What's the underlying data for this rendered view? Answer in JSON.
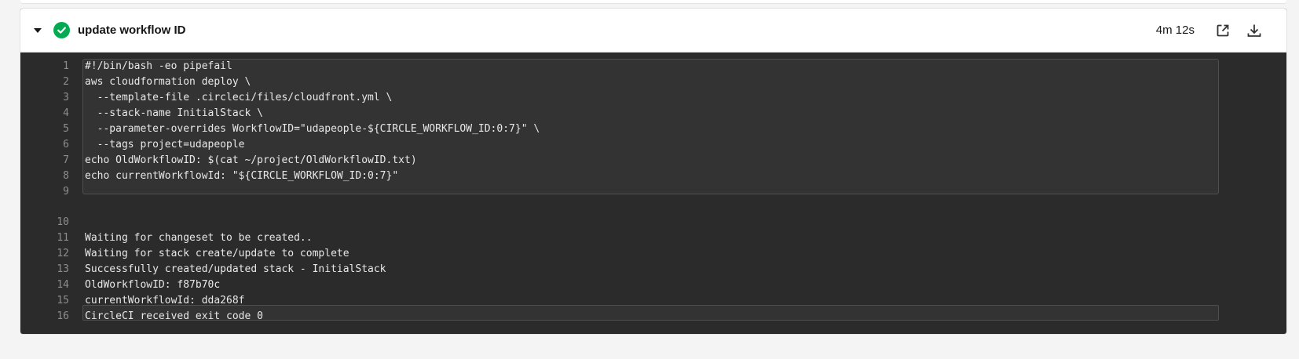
{
  "step": {
    "title": "update workflow ID",
    "duration": "4m 12s",
    "status": "success",
    "status_color": "#04aa51",
    "icons": {
      "toggle": "caret-down-icon",
      "status": "check-circle-icon",
      "external": "external-link-icon",
      "download": "download-icon"
    }
  },
  "command": {
    "lines": [
      {
        "n": "1",
        "t": "#!/bin/bash -eo pipefail"
      },
      {
        "n": "2",
        "t": "aws cloudformation deploy \\"
      },
      {
        "n": "3",
        "t": "  --template-file .circleci/files/cloudfront.yml \\"
      },
      {
        "n": "4",
        "t": "  --stack-name InitialStack \\"
      },
      {
        "n": "5",
        "t": "  --parameter-overrides WorkflowID=\"udapeople-${CIRCLE_WORKFLOW_ID:0:7}\" \\"
      },
      {
        "n": "6",
        "t": "  --tags project=udapeople"
      },
      {
        "n": "7",
        "t": "echo OldWorkflowID: $(cat ~/project/OldWorkflowID.txt)"
      },
      {
        "n": "8",
        "t": "echo currentWorkflowId: \"${CIRCLE_WORKFLOW_ID:0:7}\""
      },
      {
        "n": "9",
        "t": ""
      }
    ]
  },
  "output": {
    "lines": [
      {
        "n": "10",
        "t": ""
      },
      {
        "n": "11",
        "t": "Waiting for changeset to be created.."
      },
      {
        "n": "12",
        "t": "Waiting for stack create/update to complete"
      },
      {
        "n": "13",
        "t": "Successfully created/updated stack - InitialStack"
      },
      {
        "n": "14",
        "t": "OldWorkflowID: f87b70c"
      },
      {
        "n": "15",
        "t": "currentWorkflowId: dda268f"
      },
      {
        "n": "16",
        "t": "CircleCI received exit code 0"
      }
    ]
  }
}
